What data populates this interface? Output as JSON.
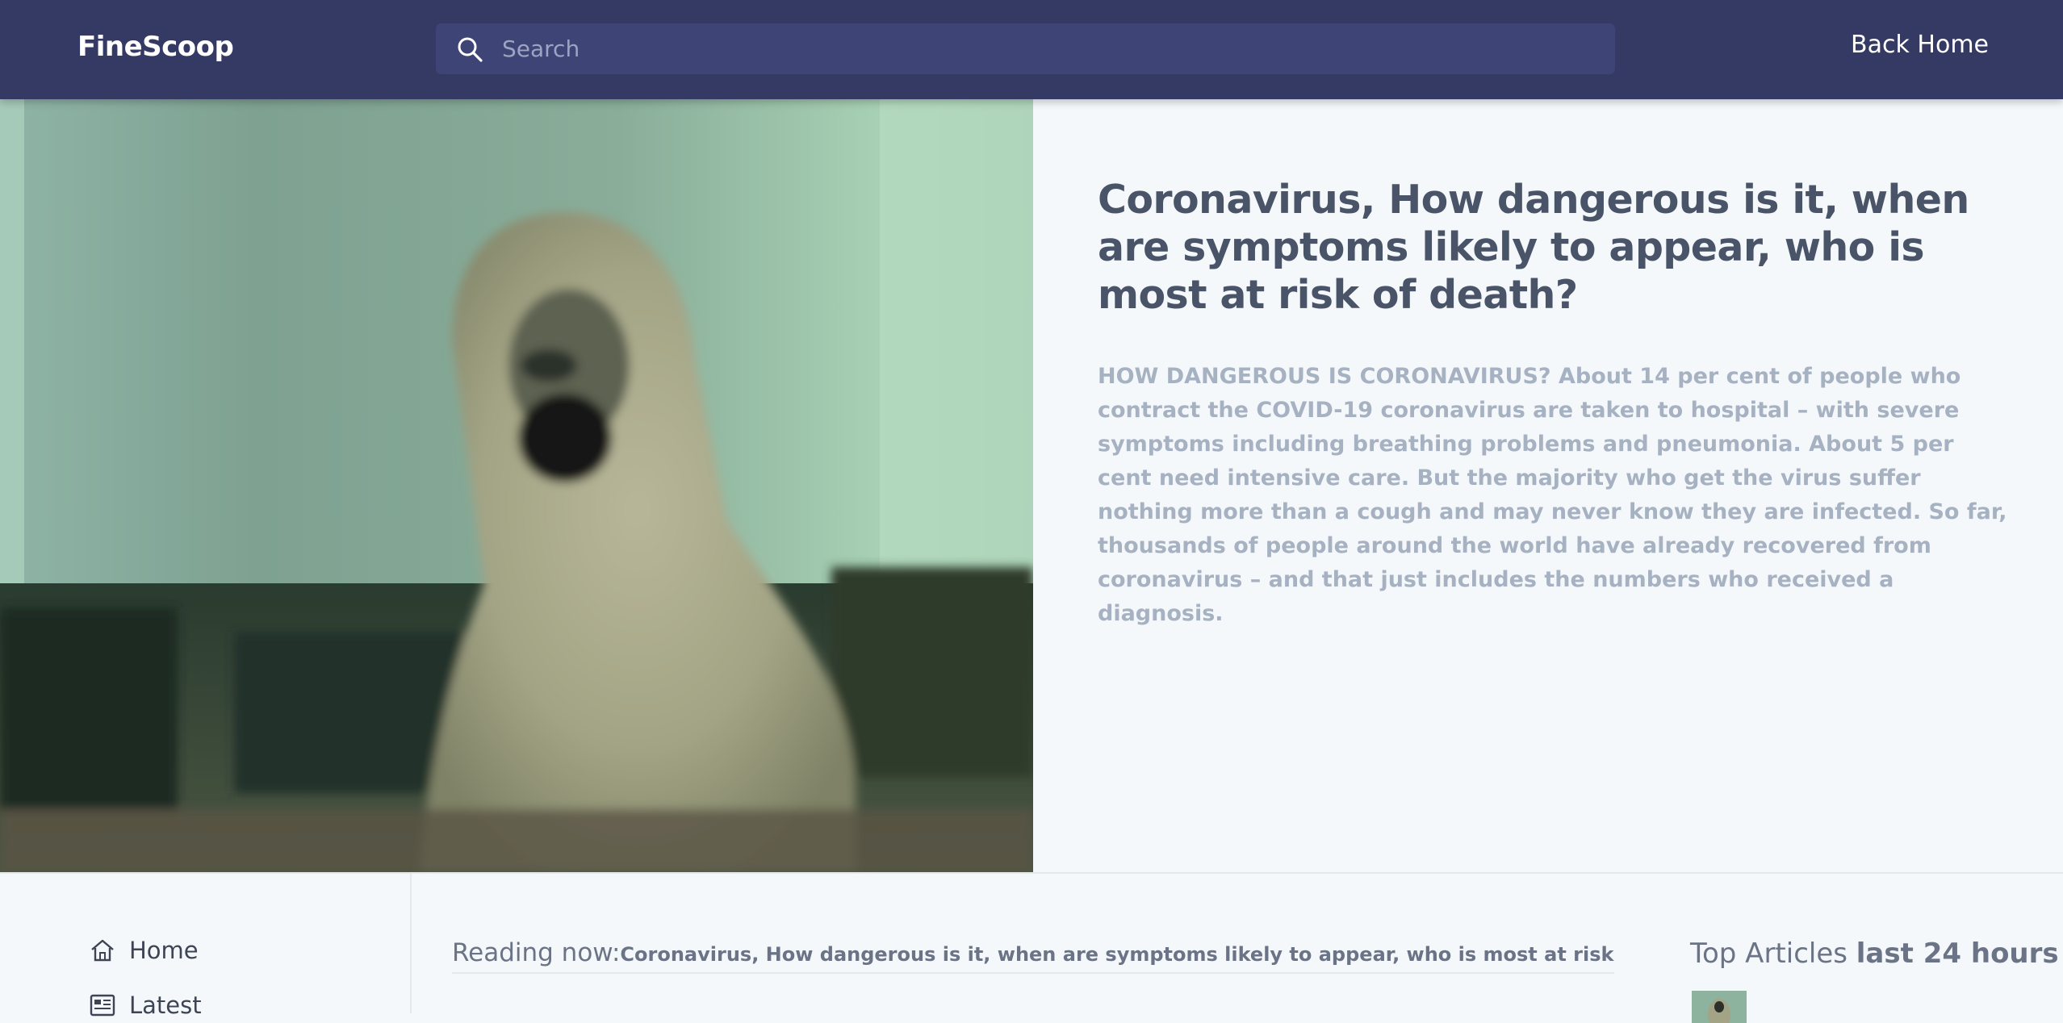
{
  "header": {
    "brand": "FineScoop",
    "search_placeholder": "Search",
    "back_home_label": "Back Home"
  },
  "article": {
    "title": "Coronavirus, How dangerous is it, when are symptoms likely to appear, who is most at risk of death?",
    "summary": "HOW DANGEROUS IS CORONAVIRUS? About 14 per cent of people who contract the COVID-19 coronavirus are taken to hospital – with severe symptoms including breathing problems and pneumonia. About 5 per cent need intensive care. But the majority who get the virus suffer nothing more than a cough and may never know they are infected. So far, thousands of people around the world have already recovered from coronavirus – and that just includes the numbers who received a diagnosis."
  },
  "sidebar": {
    "items": [
      {
        "label": "Home",
        "icon": "home-icon"
      },
      {
        "label": "Latest",
        "icon": "newspaper-icon"
      }
    ]
  },
  "reading_now": {
    "label": "Reading now:",
    "title": "Coronavirus, How dangerous is it, when are symptoms likely to appear, who is most at risk of death?"
  },
  "top_articles": {
    "label": "Top Articles ",
    "bold": "last 24 hours"
  },
  "colors": {
    "header_bg": "#343a64",
    "search_bg": "#3e4576",
    "title_text": "#4a5468",
    "summary_text": "#a6b1c2",
    "page_bg": "#f5f8fb"
  }
}
